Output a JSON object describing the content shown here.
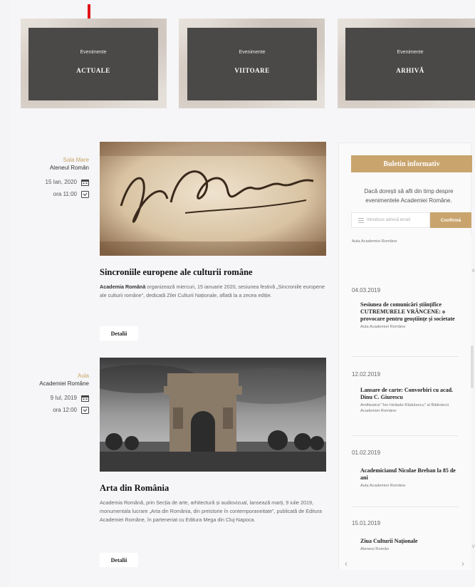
{
  "tiles": [
    {
      "small": "Evenimente",
      "big": "ACTUALE"
    },
    {
      "small": "Evenimente",
      "big": "VIITOARE"
    },
    {
      "small": "Evenimente",
      "big": "ARHIVĂ"
    }
  ],
  "events": [
    {
      "hall": "Sala Mare",
      "place": "Ateneul Român",
      "date": "15 Ian, 2020",
      "time": "ora 11:00",
      "title": "Sincroniile europene ale culturii române",
      "desc_bold": "Academia Română",
      "desc": " organizează miercuri, 15 ianuarie 2020, sesiunea festivă „Sincroniile europene ale culturii române”, dedicată Zilei Culturii Naționale, aflată la a zecea ediție.",
      "button": "Detalii"
    },
    {
      "hall": "Aula",
      "place": "Academiei Române",
      "date": "9 Iul, 2019",
      "time": "ora 12:00",
      "title": "Arta din România",
      "desc_bold": "",
      "desc": "Academia Română, prin Secția de arte, arhitectură și audiovizual, lansează marți, 9 iulie 2019, monumentala lucrare „Arta din România, din preistorie în contemporaneitate”, publicată de Editura Academiei Române, în parteneriat cu Editura Mega din Cluj-Napoca.",
      "button": "Detalii"
    }
  ],
  "newsletter": {
    "title": "Buletin informativ",
    "text": "Dacă dorești să afli din timp despre evenimentele Academiei Române.",
    "placeholder": "Introduce adresă email",
    "confirm": "Confirmă"
  },
  "archive": {
    "top_partial": "Aula Academiei Române",
    "items": [
      {
        "date": "04.03.2019",
        "title": "Sesiunea de comunicări științifice CUTREMURELE VRÂNCENE: o provocare pentru geoștiințe și societate",
        "loc": "Aula Academiei Române"
      },
      {
        "date": "12.02.2019",
        "title": "Lansare de carte: Convorbiri cu acad. Dinu C. Giurescu",
        "loc": "Amfiteatrul \"Ion Heliade Rădulescu\" al Bibliotecii Academiei Române"
      },
      {
        "date": "01.02.2019",
        "title": "Academicianul Nicolae Breban la 85 de ani",
        "loc": "Aula Academiei Române"
      },
      {
        "date": "15.01.2019",
        "title": "Ziua Culturii Naționale",
        "loc": "Ateneul Român"
      }
    ]
  },
  "colors": {
    "accent": "#c9a46d",
    "tile": "#4a4948",
    "arrow": "#e0141a"
  }
}
